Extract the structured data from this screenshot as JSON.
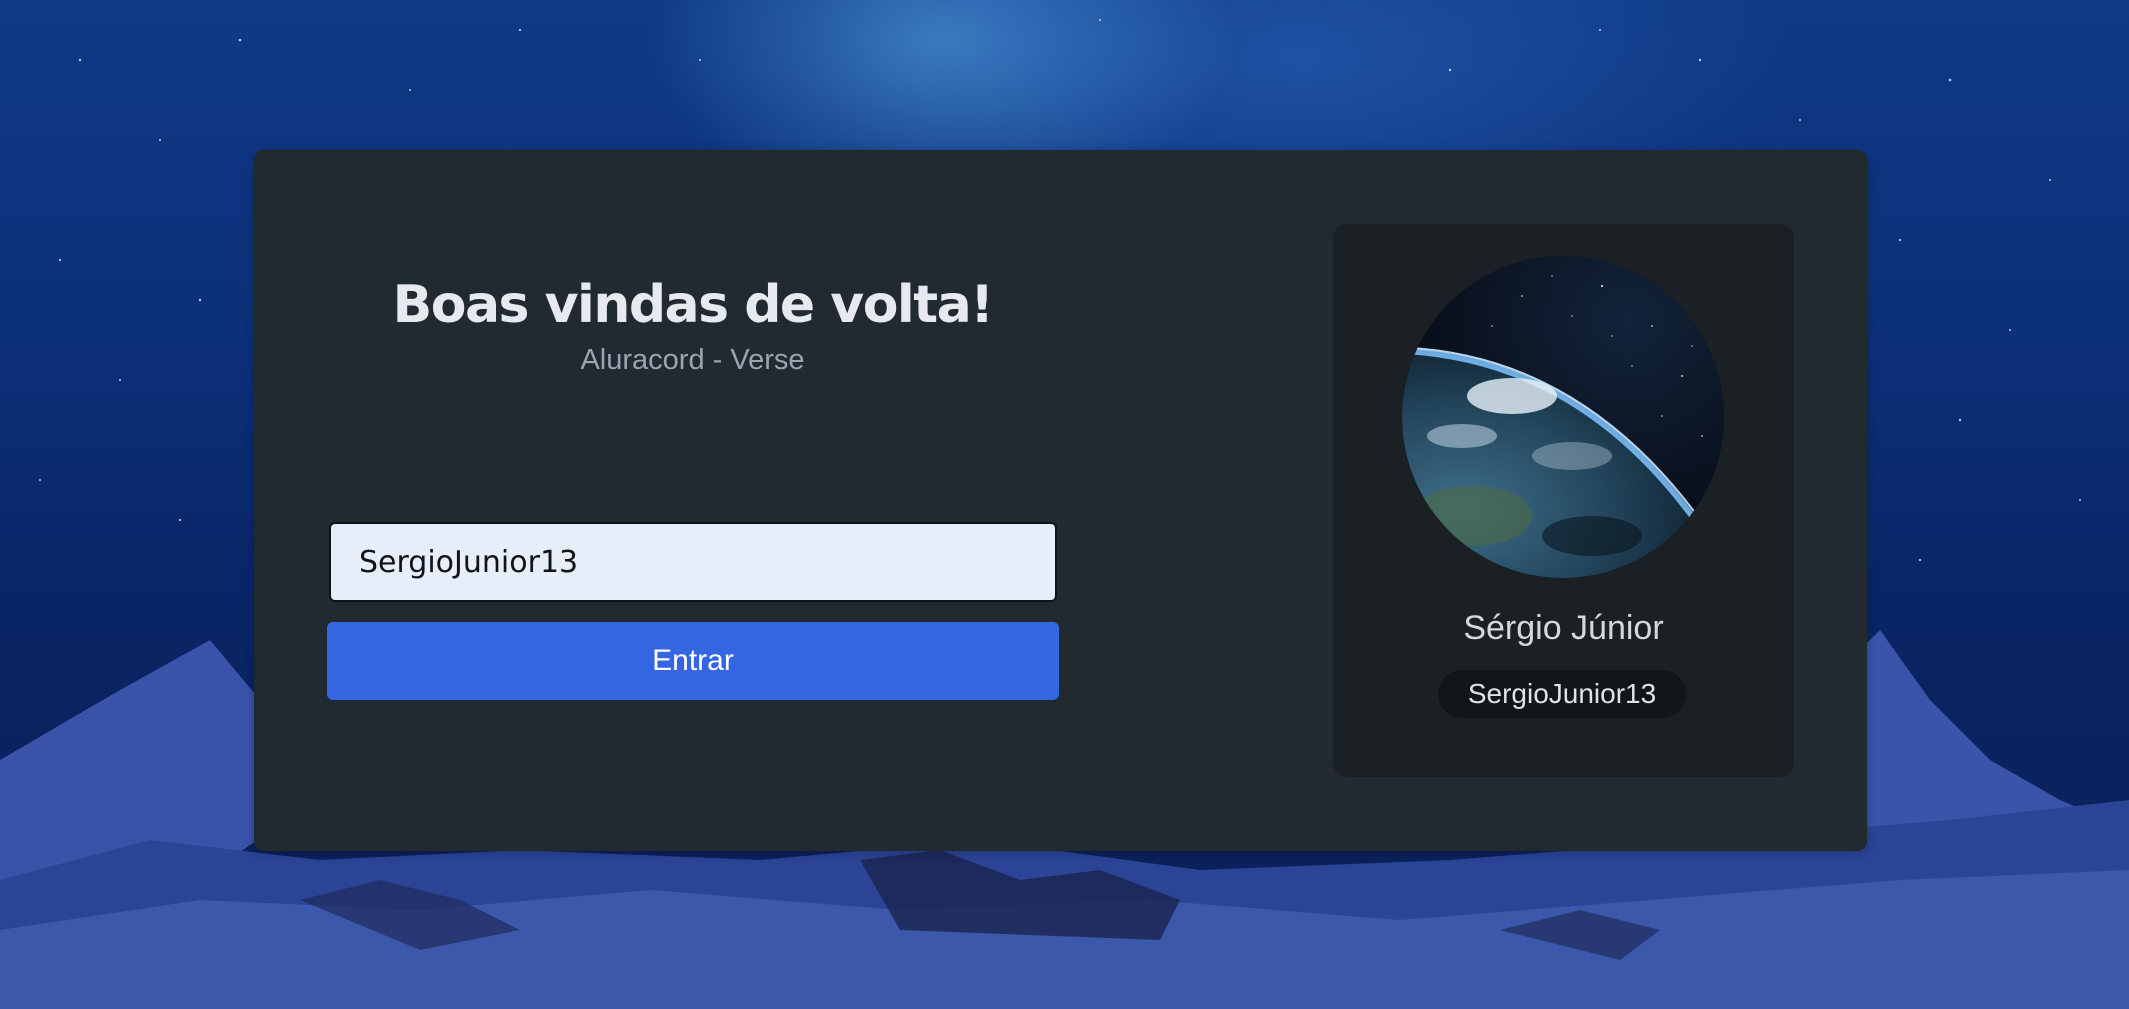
{
  "background": {
    "scene": "night sky with aurora over snowy mountains"
  },
  "login": {
    "title": "Boas vindas de volta!",
    "subtitle": "Aluracord - Verse",
    "username_value": "SergioJunior13",
    "enter_label": "Entrar"
  },
  "profile": {
    "avatar_image": "earth-from-space",
    "name": "Sérgio Júnior",
    "username": "SergioJunior13"
  },
  "colors": {
    "card_bg": "#212931",
    "panel_bg": "#1b2025",
    "button_bg": "#3366e0",
    "input_bg": "#e8eef9"
  }
}
